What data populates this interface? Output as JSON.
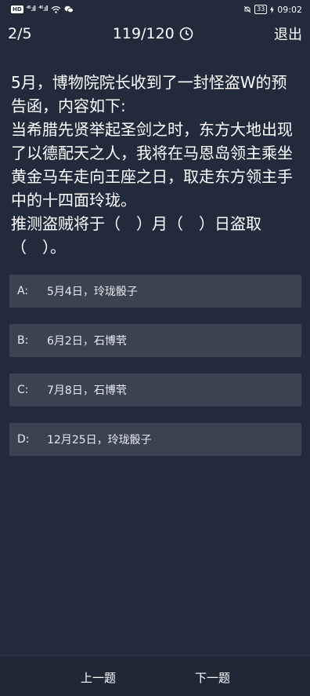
{
  "status_bar": {
    "hd": "HD",
    "signal1": "⁴⁶.ıll",
    "signal2": "⁴⁶.ıll",
    "battery": "33",
    "time": "09:02"
  },
  "top_bar": {
    "progress": "2/5",
    "timer": "119/120",
    "exit_label": "退出"
  },
  "question": {
    "text": "5月，博物院院长收到了一封怪盗W的预告函，内容如下:\n当希腊先贤举起圣剑之时，东方大地出现了以德配天之人，我将在马恩岛领主乘坐黄金马车走向王座之日，取走东方领主手中的十四面玲珑。\n推测盗贼将于（　）月（　）日盗取（　）。"
  },
  "options": [
    {
      "letter": "A:",
      "text": "5月4日，玲珑骰子"
    },
    {
      "letter": "B:",
      "text": "6月2日，石博茕"
    },
    {
      "letter": "C:",
      "text": "7月8日，石博茕"
    },
    {
      "letter": "D:",
      "text": "12月25日，玲珑骰子"
    }
  ],
  "bottom_bar": {
    "prev_label": "上一题",
    "next_label": "下一题"
  },
  "colors": {
    "background": "#222b3b",
    "option_bg": "#3b4352",
    "bottom_bg": "#202838"
  }
}
